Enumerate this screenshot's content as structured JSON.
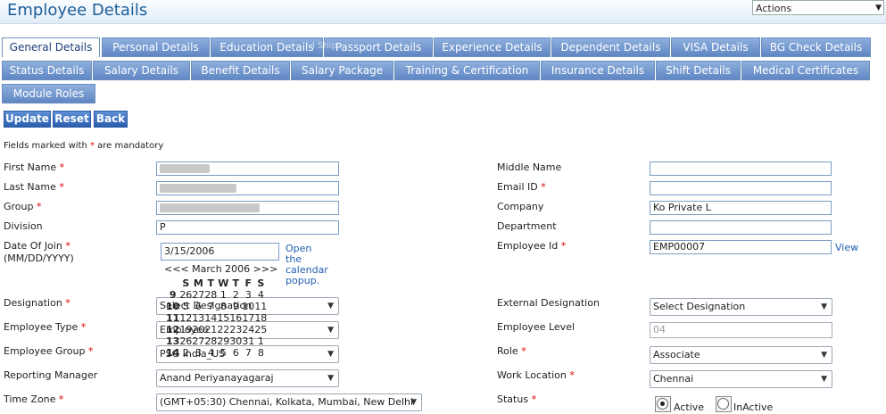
{
  "header": {
    "title": "Employee Details",
    "actions_label": "Actions"
  },
  "tabs_row1": [
    "General Details",
    "Personal Details",
    "Education Details",
    "Passport Details",
    "Experience Details",
    "Dependent Details",
    "VISA Details",
    "BG Check Details"
  ],
  "tabs_row2": [
    "Status Details",
    "Salary Details",
    "Benefit Details",
    "Salary Package",
    "Training & Certification",
    "Insurance Details",
    "Shift Details",
    "Medical Certificates"
  ],
  "tabs_row3": [
    "Module Roles"
  ],
  "tab_overlay_text": "l Ship",
  "buttons": {
    "update": "Update",
    "reset": "Reset",
    "back": "Back"
  },
  "mandatory_note": {
    "pre": "Fields marked with ",
    "star": "*",
    "post": " are mandatory"
  },
  "form": {
    "first_name": "First Name",
    "last_name": "Last Name",
    "group": "Group",
    "division": "Division",
    "division_value": "P",
    "date_of_join": "Date Of Join",
    "date_format": "(MM/DD/YYYY)",
    "date_value": "3/15/2006",
    "calendar_link": [
      "Open",
      "the",
      "calendar",
      "popup."
    ],
    "designation": "Designation",
    "designation_value": "Select Designation",
    "employee_type": "Employee Type",
    "employee_type_value": "Employee",
    "employee_group": "Employee Group",
    "employee_group_value": "PSG India_US",
    "reporting_manager": "Reporting Manager",
    "reporting_manager_value": "Anand Periyanayagaraj",
    "time_zone": "Time Zone",
    "time_zone_value": "(GMT+05:30) Chennai, Kolkata, Mumbai, New Delhi",
    "middle_name": "Middle Name",
    "email_id": "Email ID",
    "company": "Company",
    "company_value": "Ko                  Private L",
    "department": "Department",
    "employee_id": "Employee Id",
    "employee_id_value": "EMP00007",
    "view_link": "View",
    "external_designation": "External Designation",
    "external_designation_value": "Select Designation",
    "employee_level": "Employee Level",
    "employee_level_value": "04",
    "role": "Role",
    "role_value": "Associate",
    "work_location": "Work Location",
    "work_location_value": "Chennai",
    "status": "Status",
    "status_active": "Active",
    "status_inactive": "InActive"
  },
  "calendar": {
    "nav": "<<< March 2006 >>>",
    "days": [
      "S",
      "M",
      "T",
      "W",
      "T",
      "F",
      "S"
    ],
    "rows": [
      [
        "9",
        "26",
        "27",
        "28",
        "1",
        "2",
        "3",
        "4"
      ],
      [
        "10",
        "5",
        "6",
        "7",
        "8",
        "9",
        "10",
        "11"
      ],
      [
        "11",
        "12",
        "13",
        "14",
        "15",
        "16",
        "17",
        "18"
      ],
      [
        "12",
        "19",
        "20",
        "21",
        "22",
        "23",
        "24",
        "25"
      ],
      [
        "13",
        "26",
        "27",
        "28",
        "29",
        "30",
        "31",
        "1"
      ],
      [
        "14",
        "2",
        "3",
        "4",
        "5",
        "6",
        "7",
        "8"
      ]
    ]
  }
}
